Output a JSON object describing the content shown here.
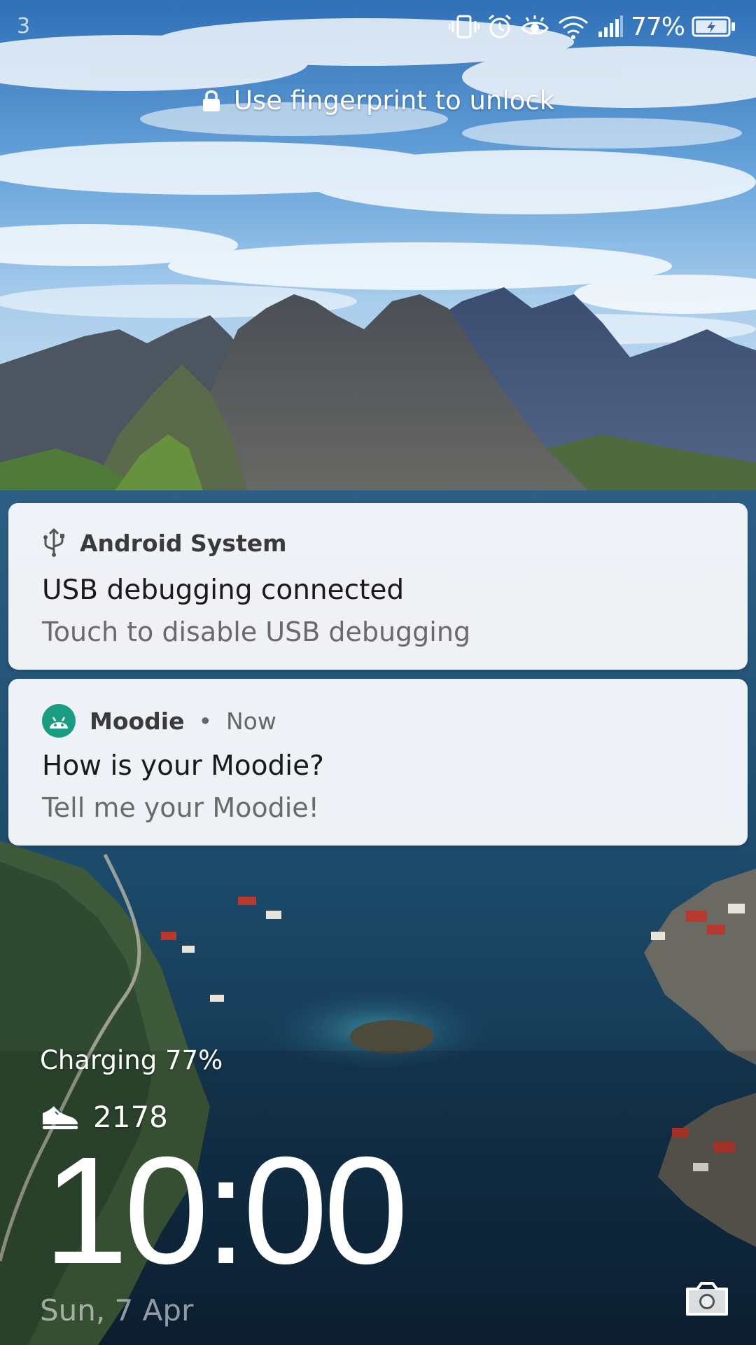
{
  "status_bar": {
    "notification_count": "3",
    "battery_percent": "77%",
    "icons": [
      "vibrate-icon",
      "alarm-icon",
      "eye-comfort-icon",
      "wifi-icon",
      "cellular-signal-icon",
      "battery-charging-icon"
    ]
  },
  "lock": {
    "hint": "Use fingerprint to unlock",
    "icon": "lock-icon"
  },
  "notifications": [
    {
      "app": "Android System",
      "icon": "usb-icon",
      "title": "USB debugging connected",
      "text": "Touch to disable USB debugging"
    },
    {
      "app": "Moodie",
      "separator": "•",
      "time": "Now",
      "icon": "android-app-icon",
      "title": "How is your Moodie?",
      "text": "Tell me your Moodie!"
    }
  ],
  "lockscreen": {
    "charging": "Charging 77%",
    "steps": "2178",
    "steps_icon": "shoe-icon",
    "time": "10:00",
    "date": "Sun, 7 Apr",
    "camera_icon": "camera-icon"
  },
  "colors": {
    "card_bg": "#fafafc",
    "moodie_icon": "#1a9c82"
  }
}
